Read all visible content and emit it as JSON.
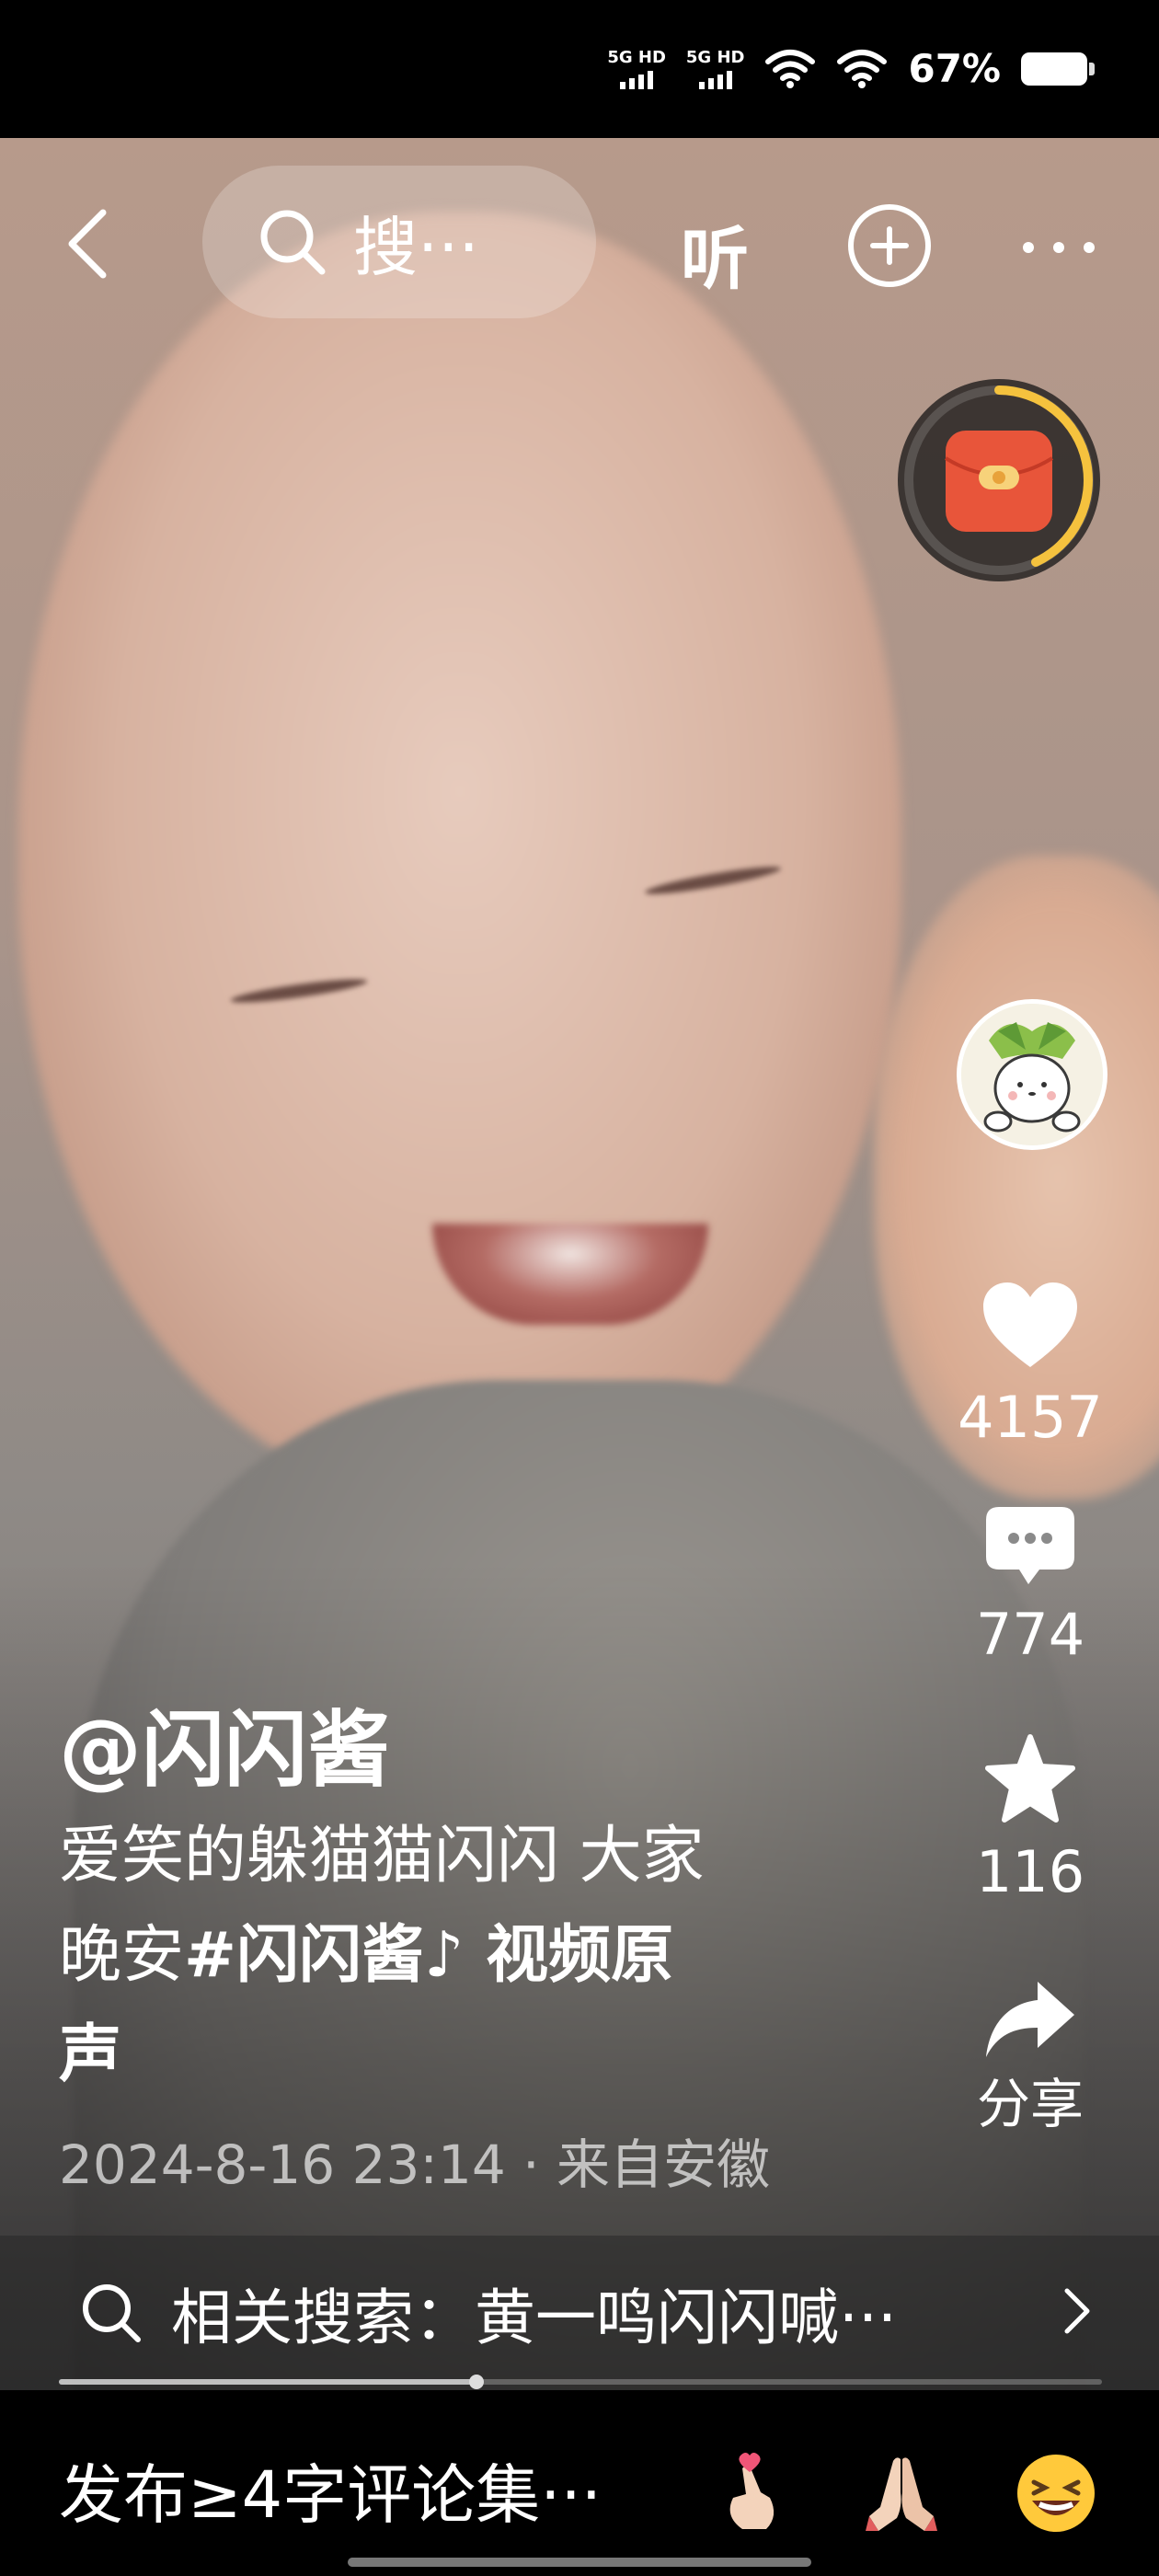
{
  "status_bar": {
    "network1": "5G HD",
    "network2": "5G HD",
    "battery_percent": "67%"
  },
  "top_nav": {
    "search_text": "搜···",
    "listen_label": "听"
  },
  "actions": {
    "like_count": "4157",
    "comment_count": "774",
    "favorite_count": "116",
    "share_label": "分享"
  },
  "caption": {
    "author": "@闪闪酱",
    "description_line1": "爱笑的躲猫猫闪闪 大家",
    "description_line2_prefix": "晚安",
    "hashtag": "#闪闪酱",
    "music_suffix": "♪ 视频原",
    "description_line3": "声",
    "date": "2024-8-16 23:14",
    "location": " · 来自安徽"
  },
  "related_search": {
    "label": "相关搜索：黄一鸣闪闪喊···"
  },
  "progress": {
    "fraction": 0.4
  },
  "comment_bar": {
    "placeholder": "发布≥4字评论集···",
    "emojis": [
      "🫰",
      "🙏",
      "😆"
    ]
  },
  "colors": {
    "accent_red": "#e8553a",
    "ring_yellow": "#f5c23e",
    "background": "#000000"
  }
}
